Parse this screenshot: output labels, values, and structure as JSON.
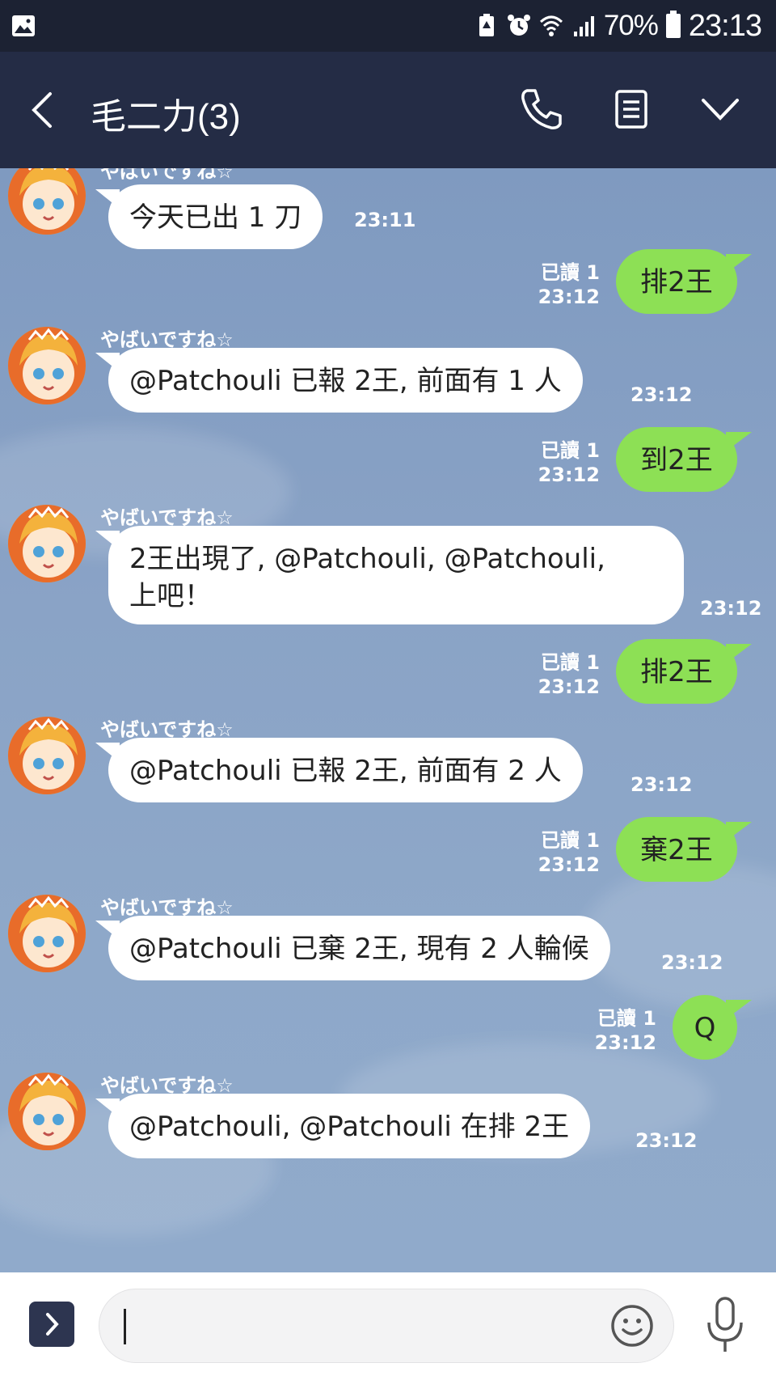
{
  "status_bar": {
    "battery": "70%",
    "time": "23:13"
  },
  "header": {
    "title": "毛二力(3)"
  },
  "messages": [
    {
      "sender": "やばいですね☆",
      "text": "今天已出 1 刀",
      "time": "23:11"
    },
    {
      "text": "排2王",
      "read": "已讀 1",
      "time": "23:12"
    },
    {
      "sender": "やばいですね☆",
      "text": "@Patchouli 已報 2王, 前面有 1 人",
      "time": "23:12"
    },
    {
      "text": "到2王",
      "read": "已讀 1",
      "time": "23:12"
    },
    {
      "sender": "やばいですね☆",
      "line1": "2王出現了, @Patchouli, @Patchouli,",
      "line2": "上吧！",
      "time": "23:12"
    },
    {
      "text": "排2王",
      "read": "已讀 1",
      "time": "23:12"
    },
    {
      "sender": "やばいですね☆",
      "text": "@Patchouli 已報 2王, 前面有 2 人",
      "time": "23:12"
    },
    {
      "text": "棄2王",
      "read": "已讀 1",
      "time": "23:12"
    },
    {
      "sender": "やばいですね☆",
      "text": "@Patchouli 已棄 2王, 現有 2 人輪候",
      "time": "23:12"
    },
    {
      "text": "Q",
      "read": "已讀 1",
      "time": "23:12"
    },
    {
      "sender": "やばいですね☆",
      "text": "@Patchouli, @Patchouli 在排 2王",
      "time": "23:12"
    }
  ],
  "input": {
    "value": ""
  },
  "colors": {
    "header_bg": "#242c45",
    "status_bg": "#1c2233",
    "chat_bg": "#7f9bc0",
    "sent_bubble": "#8de055",
    "received_bubble": "#ffffff"
  }
}
